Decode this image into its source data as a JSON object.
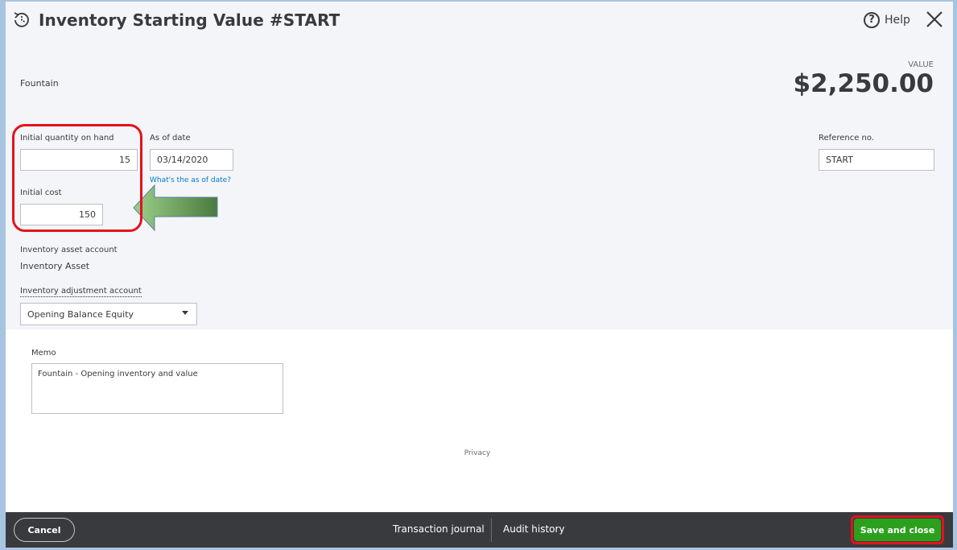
{
  "header": {
    "title": "Inventory Starting Value  #START",
    "help_label": "Help",
    "help_icon": "question-circle-icon",
    "close_icon": "close-icon",
    "app_icon": "refresh-clock-icon"
  },
  "product": {
    "name": "Fountain"
  },
  "value": {
    "label": "VALUE",
    "amount": "$2,250.00"
  },
  "form": {
    "initial_qty_label": "Initial quantity on hand",
    "initial_qty_value": "15",
    "as_of_date_label": "As of date",
    "as_of_date_value": "03/14/2020",
    "as_of_date_help_link": "What's the as of date?",
    "initial_cost_label": "Initial cost",
    "initial_cost_value": "150",
    "reference_label": "Reference no.",
    "reference_value": "START",
    "asset_account_label": "Inventory asset account",
    "asset_account_value": "Inventory Asset",
    "adjustment_account_label": "Inventory adjustment account",
    "adjustment_account_value": "Opening Balance Equity",
    "memo_label": "Memo",
    "memo_value": "Fountain - Opening inventory and value"
  },
  "privacy_link": "Privacy",
  "footer": {
    "cancel_label": "Cancel",
    "transaction_journal_label": "Transaction journal",
    "audit_history_label": "Audit history",
    "save_label": "Save and close"
  },
  "colors": {
    "highlight_red": "#e4121c",
    "arrow_green": "#6aa84f",
    "save_green": "#2ca01c",
    "footer_dark": "#393a3d",
    "link_blue": "#0077c5"
  }
}
